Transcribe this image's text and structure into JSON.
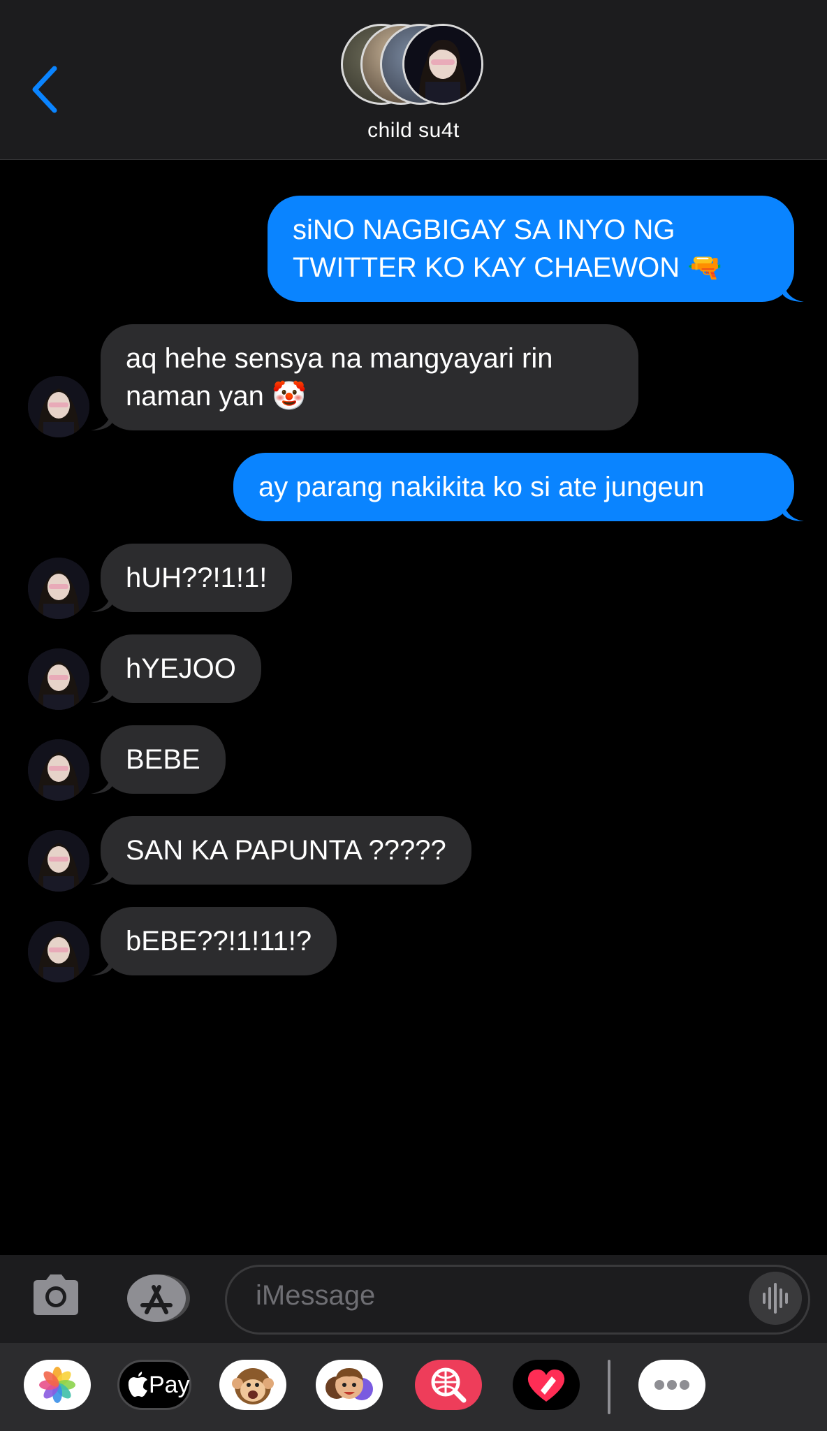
{
  "header": {
    "title": "child su4t",
    "back_icon": "chevron-left-icon"
  },
  "colors": {
    "outgoing": "#0a84ff",
    "incoming": "#2c2c2e",
    "background": "#000000",
    "header": "#1c1c1e"
  },
  "messages": [
    {
      "direction": "out",
      "text": "siNO NAGBIGAY SA INYO NG TWITTER KO KAY CHAEWON 🔫"
    },
    {
      "direction": "in",
      "text": "aq hehe sensya na mangyayari rin naman yan 🤡"
    },
    {
      "direction": "out",
      "text": "ay parang nakikita ko si ate jungeun"
    },
    {
      "direction": "in",
      "text": "hUH??!1!1!"
    },
    {
      "direction": "in",
      "text": "hYEJOO"
    },
    {
      "direction": "in",
      "text": "BEBE"
    },
    {
      "direction": "in",
      "text": "SAN KA PAPUNTA ?????"
    },
    {
      "direction": "in",
      "text": "bEBE??!1!11!?"
    }
  ],
  "input": {
    "placeholder": "iMessage"
  },
  "drawer": {
    "apple_pay_label": "Pay",
    "icons": [
      "photos-icon",
      "apple-pay-icon",
      "animoji-icon",
      "memoji-icon",
      "image-search-icon",
      "digital-touch-icon",
      "more-icon"
    ]
  }
}
